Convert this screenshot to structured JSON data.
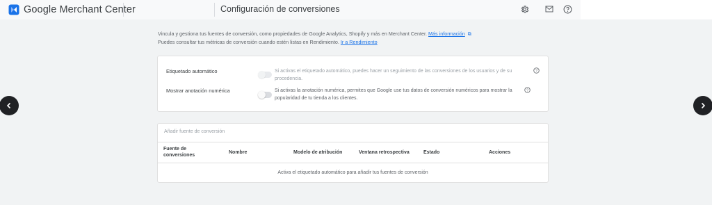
{
  "header": {
    "brand": "Google Merchant Center",
    "page_title": "Configuración de conversiones",
    "icons": [
      "gear-icon",
      "mail-icon",
      "help-icon"
    ]
  },
  "intro": {
    "line1": "Vincula y gestiona tus fuentes de conversión, como propiedades de Google Analytics, Shopify y más en Merchant Center.",
    "learn_more": "Más información",
    "line2": "Puedes consultar tus métricas de conversión cuando estén listas en Rendimiento.",
    "go_to": "Ir a Rendimiento"
  },
  "settings": {
    "auto_tagging": {
      "label": "Etiquetado automático",
      "description": "Si activas el etiquetado automático, puedes hacer un seguimiento de las conversiones de los usuarios y de su procedencia."
    },
    "numeric_annotation": {
      "label": "Mostrar anotación numérica",
      "description": "Si activas la anotación numérica, permites que Google use tus datos de conversión numéricos para mostrar la popularidad de tu tienda a los clientes."
    }
  },
  "sources": {
    "add_placeholder": "Añadir fuente de conversión",
    "columns": {
      "source_line1": "Fuente de",
      "source_line2": "conversiones",
      "name": "Nombre",
      "attribution": "Modelo de atribución",
      "lookback": "Ventana retrospectiva",
      "status": "Estado",
      "actions": "Acciones"
    },
    "empty_message": "Activa el etiquetado automático para añadir tus fuentes de conversión"
  },
  "colors": {
    "accent": "#1a73e8",
    "nav_button": "#202124",
    "background": "#f1f3f4"
  }
}
